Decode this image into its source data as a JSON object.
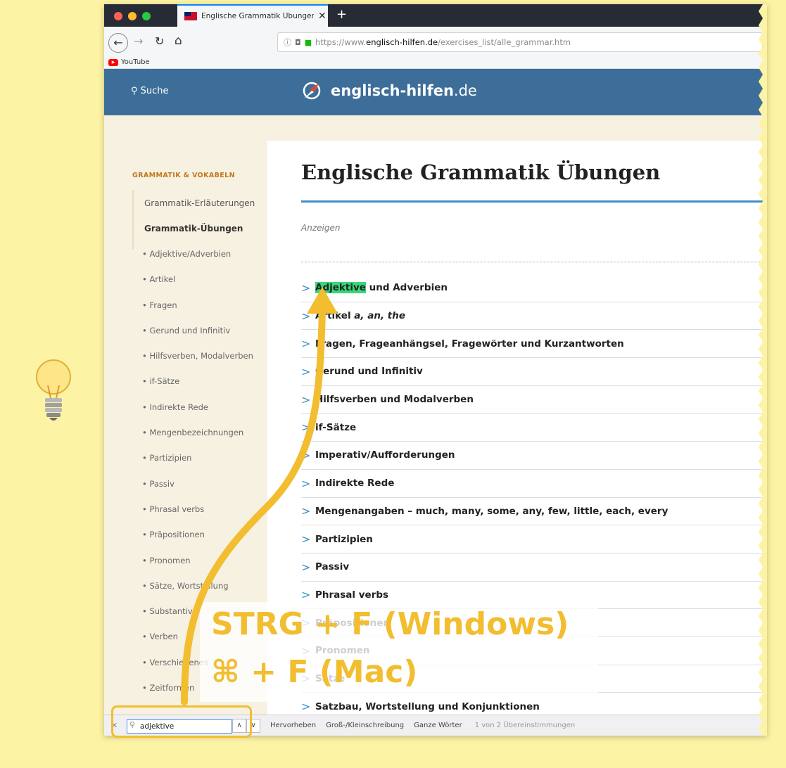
{
  "tab": {
    "title": "Englische Grammatik Übungen",
    "close": "✕",
    "new_tab": "+"
  },
  "url": {
    "scheme": "https://www.",
    "domain": "englisch-hilfen.de",
    "path": "/exercises_list/alle_grammar.htm"
  },
  "bookmarks": [
    {
      "label": "YouTube"
    }
  ],
  "header": {
    "search_label": "Suche",
    "logo_name": "englisch-hilfen",
    "logo_tld": ".de"
  },
  "sidebar": {
    "heading": "GRAMMATIK & VOKABELN",
    "nav": [
      "Grammatik-Erläuterungen",
      "Grammatik-Übungen"
    ],
    "items": [
      "Adjektive/Adverbien",
      "Artikel",
      "Fragen",
      "Gerund und Infinitiv",
      "Hilfsverben, Modalverben",
      "if-Sätze",
      "Indirekte Rede",
      "Mengenbezeichnungen",
      "Partizipien",
      "Passiv",
      "Phrasal verbs",
      "Präpositionen",
      "Pronomen",
      "Sätze, Wortstellung",
      "Substantive",
      "Verben",
      "Verschiedenes",
      "Zeitformen"
    ]
  },
  "main": {
    "title": "Englische Grammatik Übungen",
    "ads_label": "Anzeigen",
    "highlight": "Adjektive",
    "first_rest": " und Adverbien",
    "second_prefix": "Artikel ",
    "second_italic": "a, an, the",
    "exercises": [
      "Fragen, Frageanhängsel, Fragewörter und Kurzantworten",
      "Gerund und Infinitiv",
      "Hilfsverben und Modalverben",
      "if-Sätze",
      "Imperativ/Aufforderungen",
      "Indirekte Rede",
      "Mengenangaben – much, many, some, any, few, little, each, every",
      "Partizipien",
      "Passiv",
      "Phrasal verbs",
      "Präpositionen",
      "Pronomen",
      "Sätze",
      "Satzbau, Wortstellung und Konjunktionen"
    ]
  },
  "findbar": {
    "query": "adjektive",
    "options": [
      "Hervorheben",
      "Groß-/Kleinschreibung",
      "Ganze Wörter"
    ],
    "matches": "1 von 2 Übereinstimmungen"
  },
  "overlay": {
    "windows": "STRG + F (Windows)",
    "mac": "⌘ + F (Mac)",
    "accent": "#f2bd2f"
  },
  "colors": {
    "header_blue": "#3d6e99",
    "match_green": "#38d878",
    "background": "#fdf3a4"
  }
}
